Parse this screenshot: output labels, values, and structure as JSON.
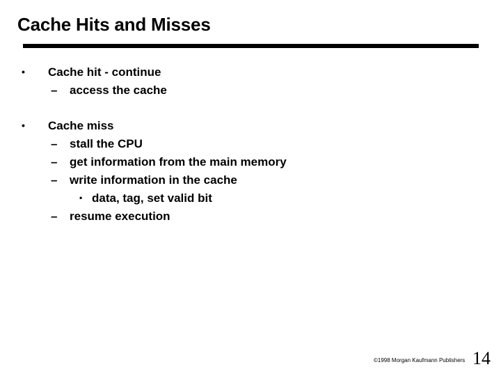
{
  "slide": {
    "title": "Cache Hits and Misses",
    "bullets": [
      {
        "text": "Cache hit - continue",
        "sub": [
          {
            "text": "access the cache"
          }
        ]
      },
      {
        "text": "Cache miss",
        "sub": [
          {
            "text": "stall the CPU"
          },
          {
            "text": "get information from the main memory"
          },
          {
            "text": "write information in the cache",
            "sub": [
              {
                "text": "data, tag, set valid bit"
              }
            ]
          },
          {
            "text": "resume execution"
          }
        ]
      }
    ],
    "markers": {
      "level1": "•",
      "level2": "–",
      "level3": "•"
    },
    "footer": "©1998 Morgan Kaufmann Publishers",
    "page_number": "14"
  }
}
